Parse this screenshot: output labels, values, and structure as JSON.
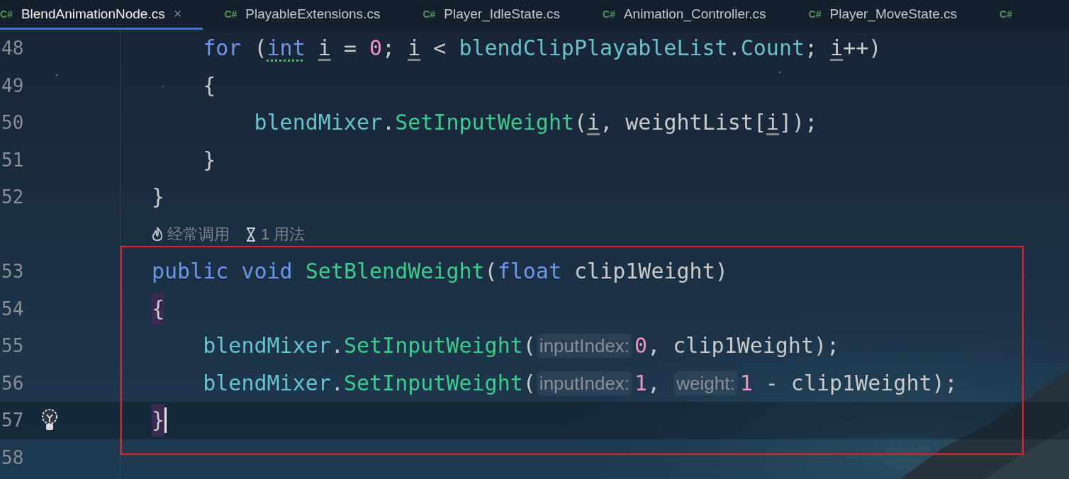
{
  "tabs": [
    {
      "lang": "C#",
      "label": "BlendAnimationNode.cs",
      "selected": true,
      "close": "×"
    },
    {
      "lang": "C#",
      "label": "PlayableExtensions.cs",
      "selected": false
    },
    {
      "lang": "C#",
      "label": "Player_IdleState.cs",
      "selected": false
    },
    {
      "lang": "C#",
      "label": "Animation_Controller.cs",
      "selected": false
    },
    {
      "lang": "C#",
      "label": "Player_MoveState.cs",
      "selected": false
    },
    {
      "lang": "C#",
      "selected": false
    }
  ],
  "lines": [
    {
      "kind": "block",
      "children": [
        {
          "kind": "code",
          "number": "48",
          "tokens": [
            {
              "text": "for",
              "kind": "keyword"
            },
            {
              "text": " (",
              "kind": "plain"
            },
            {
              "text": "int",
              "kind": "keyword",
              "underline": true
            },
            {
              "text": " i",
              "kind": "plain",
              "underline": true
            },
            {
              "text": " = ",
              "kind": "plain"
            },
            {
              "text": "0",
              "kind": "number"
            },
            {
              "text": "; ",
              "kind": "plain"
            },
            {
              "text": "i",
              "kind": "plain",
              "underline": true
            },
            {
              "text": " < ",
              "kind": "plain"
            },
            {
              "text": "blendClipPlayableList",
              "kind": "field"
            },
            {
              "text": ".",
              "kind": "plain"
            },
            {
              "text": "Count",
              "kind": "field"
            },
            {
              "text": "; ",
              "kind": "plain"
            },
            {
              "text": "i",
              "kind": "plain",
              "underline": true
            },
            {
              "text": "++)",
              "kind": "plain"
            }
          ]
        },
        {
          "kind": "code",
          "number": "49",
          "tokens": [
            {
              "text": "{",
              "kind": "plain"
            }
          ]
        },
        {
          "kind": "block",
          "children": [
            {
              "kind": "code",
              "number": "50",
              "tokens": [
                {
                  "text": "blendMixer",
                  "kind": "field"
                },
                {
                  "text": ".",
                  "kind": "plain"
                },
                {
                  "text": "SetInputWeight",
                  "kind": "method"
                },
                {
                  "text": "(",
                  "kind": "plain"
                },
                {
                  "text": "i",
                  "kind": "plain",
                  "underline": true
                },
                {
                  "text": ", weightList[",
                  "kind": "plain"
                },
                {
                  "text": "i",
                  "kind": "plain",
                  "underline": true
                },
                {
                  "text": "]);",
                  "kind": "plain"
                }
              ]
            }
          ]
        },
        {
          "kind": "code",
          "number": "51",
          "tokens": [
            {
              "text": "}",
              "kind": "plain"
            }
          ]
        }
      ]
    },
    {
      "kind": "code",
      "number": "52",
      "tokens": [
        {
          "text": "}",
          "kind": "plain"
        }
      ]
    },
    {
      "kind": "code_vision",
      "items": [
        {
          "text": "经常调用"
        },
        {
          "text": "1 用法"
        }
      ]
    },
    {
      "kind": "code",
      "number": "53",
      "tokens": [
        {
          "text": "public",
          "kind": "keyword"
        },
        {
          "text": " void",
          "kind": "keyword"
        },
        {
          "text": " SetBlendWeight",
          "kind": "method"
        },
        {
          "text": "(",
          "kind": "plain"
        },
        {
          "text": "float",
          "kind": "keyword"
        },
        {
          "text": " clip1Weight)",
          "kind": "plain"
        }
      ]
    },
    {
      "kind": "code",
      "number": "54",
      "tokens": [
        {
          "text": "{",
          "kind": "plain",
          "match": true
        }
      ]
    },
    {
      "kind": "block",
      "children": [
        {
          "kind": "code",
          "number": "55",
          "tokens": [
            {
              "text": "blendMixer",
              "kind": "field"
            },
            {
              "text": ".",
              "kind": "plain"
            },
            {
              "text": "SetInputWeight",
              "kind": "method"
            },
            {
              "text": "(",
              "kind": "plain"
            },
            {
              "text": "inputIndex:",
              "kind": "hint"
            },
            {
              "text": "0",
              "kind": "number"
            },
            {
              "text": ", clip1Weight);",
              "kind": "plain"
            }
          ]
        },
        {
          "kind": "code",
          "number": "56",
          "tokens": [
            {
              "text": "blendMixer",
              "kind": "field"
            },
            {
              "text": ".",
              "kind": "plain"
            },
            {
              "text": "SetInputWeight",
              "kind": "method"
            },
            {
              "text": "(",
              "kind": "plain"
            },
            {
              "text": "inputIndex:",
              "kind": "hint"
            },
            {
              "text": "1",
              "kind": "number"
            },
            {
              "text": ", ",
              "kind": "plain"
            },
            {
              "text": "weight:",
              "kind": "hint"
            },
            {
              "text": "1",
              "kind": "number"
            },
            {
              "text": " - clip1Weight);",
              "kind": "plain"
            }
          ]
        }
      ]
    },
    {
      "kind": "code",
      "number": "57",
      "current": true,
      "caret": true,
      "bulb": true,
      "tokens": [
        {
          "text": "}",
          "kind": "plain",
          "match": true
        }
      ]
    },
    {
      "kind": "code",
      "number": "58"
    }
  ]
}
